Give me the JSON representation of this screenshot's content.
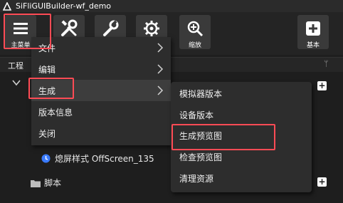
{
  "window": {
    "title": "SiFliGUIBuilder-wf_demo",
    "icon": "sifli-logo-icon"
  },
  "toolbar": {
    "menu_label": "主菜单",
    "zoom_label": "缩放",
    "basic_label": "基本"
  },
  "panel": {
    "title": "工程",
    "pin": "ᛘ"
  },
  "tree": {
    "offscreen_item": "熄屏样式 OffScreen_135",
    "script_folder": "脚本"
  },
  "main_menu": {
    "items": [
      {
        "label": "文件",
        "has_submenu": true
      },
      {
        "label": "编辑",
        "has_submenu": true
      },
      {
        "label": "生成",
        "has_submenu": true
      },
      {
        "label": "版本信息",
        "has_submenu": false
      },
      {
        "label": "关闭",
        "has_submenu": false
      }
    ]
  },
  "generate_submenu": {
    "items": [
      "模拟器版本",
      "设备版本",
      "生成预览图",
      "检查预览图",
      "清理资源"
    ]
  },
  "colors": {
    "highlight": "#ff4b55",
    "menu_bg": "#2d2d2d",
    "window_bg": "#1e1e1e",
    "clock_blue": "#3a7bff"
  }
}
